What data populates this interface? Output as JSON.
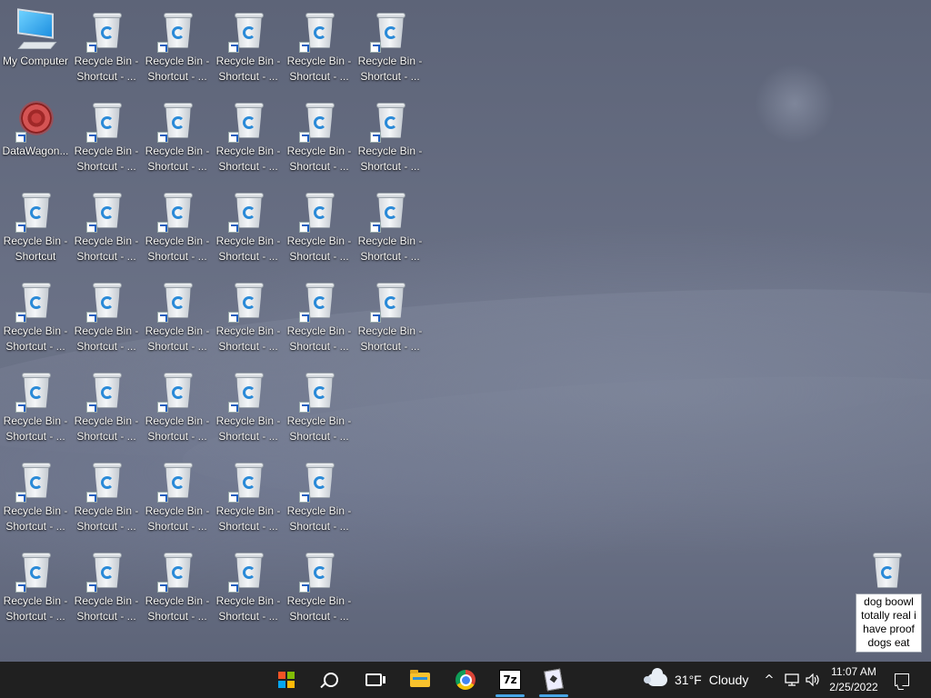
{
  "desktop": {
    "icons": {
      "my_computer": "My Computer",
      "datawagon": "DataWagon...",
      "recycle_shortcut": "Recycle Bin - Shortcut - ...",
      "recycle_shortcut_first": "Recycle Bin - Shortcut",
      "recycle_line1": "Recycle Bin -",
      "recycle_line2": "Shortcut - ...",
      "recycle_plain_line2": "Shortcut"
    },
    "note": {
      "text": "dog boowl totally real i have proof dogs eat"
    }
  },
  "taskbar": {
    "start_icon": "windows-start-icon",
    "search_icon": "search-icon",
    "taskview_icon": "task-view-icon",
    "apps": [
      {
        "name": "File Explorer",
        "icon": "folder-icon"
      },
      {
        "name": "Google Chrome",
        "icon": "chrome-icon"
      },
      {
        "name": "7-Zip",
        "icon": "7z-icon",
        "glyph": "7z"
      },
      {
        "name": "Solitaire",
        "icon": "cards-icon"
      }
    ],
    "weather": {
      "temp": "31°F",
      "condition": "Cloudy"
    },
    "tray": {
      "chevron": "^",
      "network_icon": "network-icon",
      "volume_icon": "volume-icon"
    },
    "clock": {
      "time": "11:07 AM",
      "date": "2/25/2022"
    }
  },
  "colors": {
    "taskbar_bg": "#202020",
    "accent": "#4aa7e8",
    "desktop_bg": "#6a7186"
  }
}
